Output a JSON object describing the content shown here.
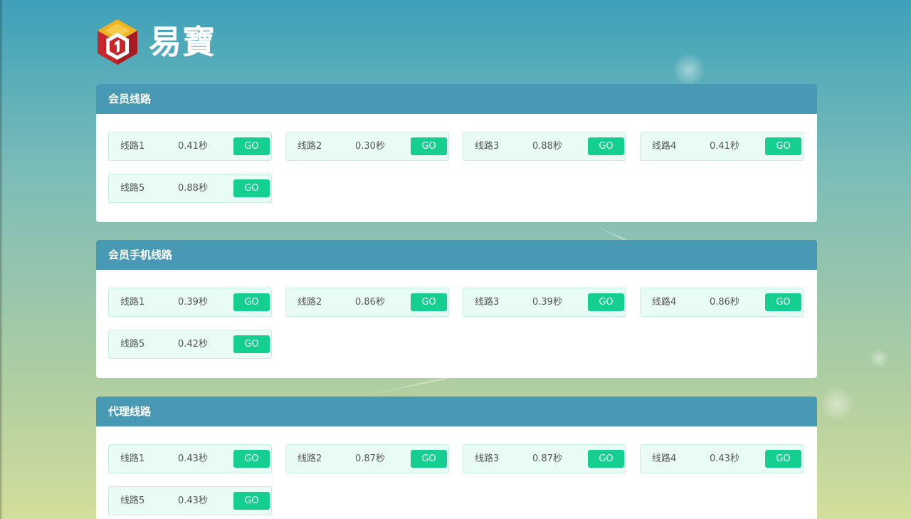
{
  "brand": {
    "logo_icon": "cube-number-1-logo-icon",
    "name": "易寶"
  },
  "colors": {
    "section_header": "#4899b4",
    "go_button": "#14cf8f",
    "route_card_bg": "#e8fbf4",
    "route_card_border": "#c7f0e0"
  },
  "sections": [
    {
      "title": "会员线路",
      "routes": [
        {
          "name": "线路1",
          "time": "0.41秒",
          "go": "GO"
        },
        {
          "name": "线路2",
          "time": "0.30秒",
          "go": "GO"
        },
        {
          "name": "线路3",
          "time": "0.88秒",
          "go": "GO"
        },
        {
          "name": "线路4",
          "time": "0.41秒",
          "go": "GO"
        },
        {
          "name": "线路5",
          "time": "0.88秒",
          "go": "GO"
        }
      ]
    },
    {
      "title": "会员手机线路",
      "routes": [
        {
          "name": "线路1",
          "time": "0.39秒",
          "go": "GO"
        },
        {
          "name": "线路2",
          "time": "0.86秒",
          "go": "GO"
        },
        {
          "name": "线路3",
          "time": "0.39秒",
          "go": "GO"
        },
        {
          "name": "线路4",
          "time": "0.86秒",
          "go": "GO"
        },
        {
          "name": "线路5",
          "time": "0.42秒",
          "go": "GO"
        }
      ]
    },
    {
      "title": "代理线路",
      "routes": [
        {
          "name": "线路1",
          "time": "0.43秒",
          "go": "GO"
        },
        {
          "name": "线路2",
          "time": "0.87秒",
          "go": "GO"
        },
        {
          "name": "线路3",
          "time": "0.87秒",
          "go": "GO"
        },
        {
          "name": "线路4",
          "time": "0.43秒",
          "go": "GO"
        },
        {
          "name": "线路5",
          "time": "0.43秒",
          "go": "GO"
        }
      ]
    }
  ]
}
